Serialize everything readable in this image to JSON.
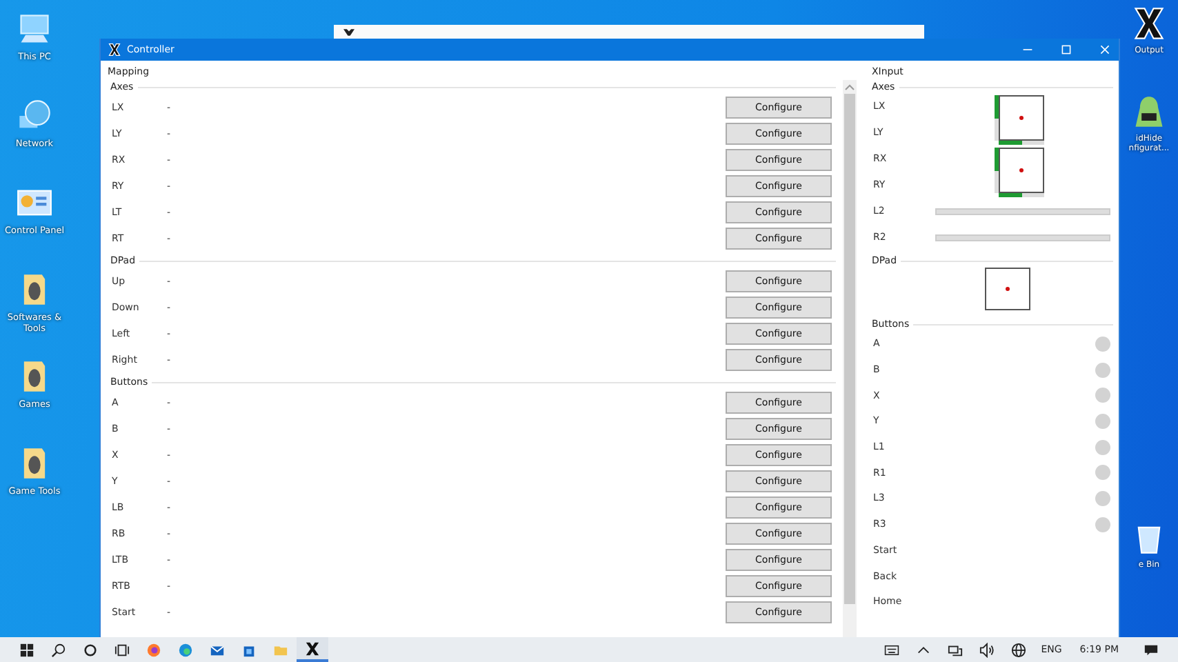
{
  "desktop_icons": [
    {
      "label": "This PC",
      "kind": "monitor"
    },
    {
      "label": "Network",
      "kind": "globe"
    },
    {
      "label": "Control Panel",
      "kind": "control-panel"
    },
    {
      "label": "Softwares & Tools",
      "kind": "folder"
    },
    {
      "label": "Games",
      "kind": "folder"
    },
    {
      "label": "Game Tools",
      "kind": "folder"
    }
  ],
  "desktop_icons_right": [
    {
      "label": "Output",
      "kind": "x-app"
    },
    {
      "label": "idHide nfigurat...",
      "kind": "app"
    },
    {
      "label": "e Bin",
      "kind": "bin"
    }
  ],
  "window": {
    "title": "Controller"
  },
  "mapping": {
    "title": "Mapping",
    "groups": [
      {
        "title": "Axes",
        "rows": [
          {
            "label": "LX",
            "value": "-",
            "button": "Configure"
          },
          {
            "label": "LY",
            "value": "-",
            "button": "Configure"
          },
          {
            "label": "RX",
            "value": "-",
            "button": "Configure"
          },
          {
            "label": "RY",
            "value": "-",
            "button": "Configure"
          },
          {
            "label": "LT",
            "value": "-",
            "button": "Configure"
          },
          {
            "label": "RT",
            "value": "-",
            "button": "Configure"
          }
        ]
      },
      {
        "title": "DPad",
        "rows": [
          {
            "label": "Up",
            "value": "-",
            "button": "Configure"
          },
          {
            "label": "Down",
            "value": "-",
            "button": "Configure"
          },
          {
            "label": "Left",
            "value": "-",
            "button": "Configure"
          },
          {
            "label": "Right",
            "value": "-",
            "button": "Configure"
          }
        ]
      },
      {
        "title": "Buttons",
        "rows": [
          {
            "label": "A",
            "value": "-",
            "button": "Configure"
          },
          {
            "label": "B",
            "value": "-",
            "button": "Configure"
          },
          {
            "label": "X",
            "value": "-",
            "button": "Configure"
          },
          {
            "label": "Y",
            "value": "-",
            "button": "Configure"
          },
          {
            "label": "LB",
            "value": "-",
            "button": "Configure"
          },
          {
            "label": "RB",
            "value": "-",
            "button": "Configure"
          },
          {
            "label": "LTB",
            "value": "-",
            "button": "Configure"
          },
          {
            "label": "RTB",
            "value": "-",
            "button": "Configure"
          },
          {
            "label": "Start",
            "value": "-",
            "button": "Configure"
          }
        ]
      }
    ]
  },
  "xinput": {
    "title": "XInput",
    "axes": {
      "title": "Axes",
      "sticks": [
        {
          "axes": [
            {
              "label": "LX",
              "level": 0.5
            },
            {
              "label": "LY",
              "level": 0.5
            }
          ]
        },
        {
          "axes": [
            {
              "label": "RX",
              "level": 0.5
            },
            {
              "label": "RY",
              "level": 0.5
            }
          ]
        }
      ],
      "triggers": [
        {
          "label": "L2",
          "level": 0
        },
        {
          "label": "R2",
          "level": 0
        }
      ]
    },
    "dpad": {
      "title": "DPad"
    },
    "buttons": {
      "title": "Buttons",
      "items": [
        {
          "label": "A",
          "pressed": false
        },
        {
          "label": "B",
          "pressed": false
        },
        {
          "label": "X",
          "pressed": false
        },
        {
          "label": "Y",
          "pressed": false
        },
        {
          "label": "L1",
          "pressed": false
        },
        {
          "label": "R1",
          "pressed": false
        },
        {
          "label": "L3",
          "pressed": false
        },
        {
          "label": "R3",
          "pressed": false
        },
        {
          "label": "Start"
        },
        {
          "label": "Back"
        },
        {
          "label": "Home"
        }
      ]
    }
  },
  "taskbar": {
    "apps": [
      {
        "kind": "firefox",
        "selected": false
      },
      {
        "kind": "edge",
        "selected": false
      },
      {
        "kind": "mail",
        "selected": false
      },
      {
        "kind": "store",
        "selected": false
      },
      {
        "kind": "folder",
        "selected": false
      },
      {
        "kind": "x-app",
        "selected": true
      }
    ],
    "language": "ENG",
    "time": "6:19 PM"
  }
}
